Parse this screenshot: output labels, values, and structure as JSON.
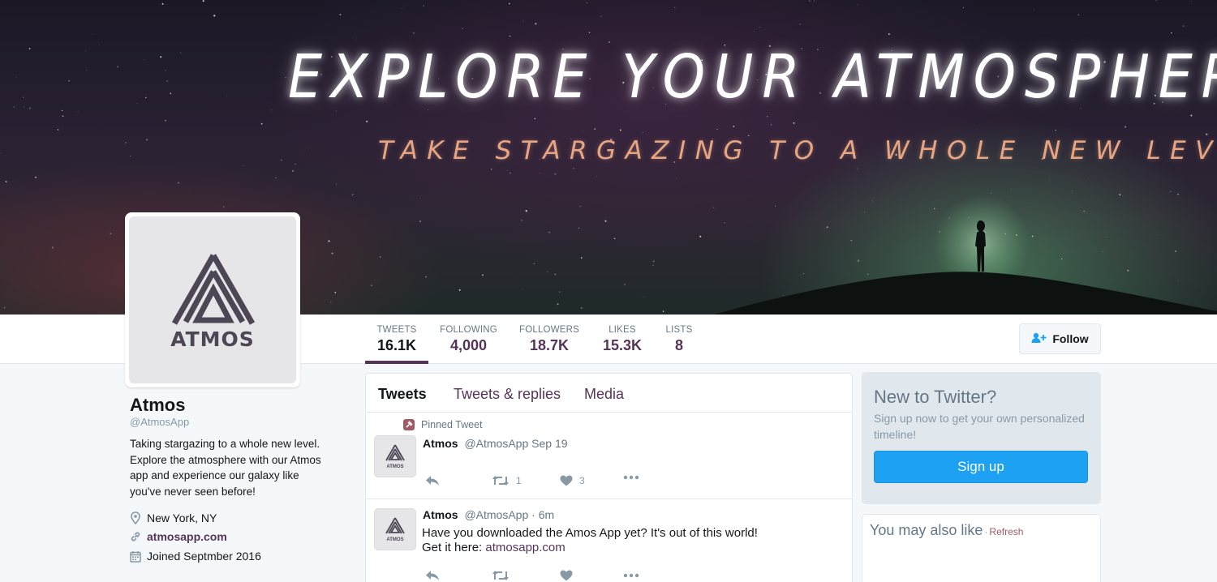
{
  "banner": {
    "title": "EXPLORE YOUR ATMOSPHERE.",
    "subtitle": "TAKE STARGAZING TO A WHOLE NEW LEVEL"
  },
  "profile": {
    "name": "Atmos",
    "handle": "@AtmosApp",
    "bio": "Taking stargazing to a whole new level. Explore the atmosphere with our Atmos app and experience our galaxy like you've never seen before!",
    "location": "New York, NY",
    "website": "atmosapp.com",
    "joined": "Joined Septmber 2016",
    "avatar_text": "ATMOS"
  },
  "stats": [
    {
      "label": "TWEETS",
      "value": "16.1K"
    },
    {
      "label": "FOLLOWING",
      "value": "4,000"
    },
    {
      "label": "FOLLOWERS",
      "value": "18.7K"
    },
    {
      "label": "LIKES",
      "value": "15.3K"
    },
    {
      "label": "LISTS",
      "value": "8"
    }
  ],
  "follow_label": "Follow",
  "tabs": [
    "Tweets",
    "Tweets & replies",
    "Media"
  ],
  "tweets": [
    {
      "pinned_label": "Pinned Tweet",
      "name": "Atmos",
      "handle": "@AtmosApp",
      "time": "Sep 19",
      "retweets": "1",
      "likes": "3"
    },
    {
      "name": "Atmos",
      "handle": "@AtmosApp",
      "time": "· 6m",
      "text": "Have you downloaded the Amos App yet? It's out of this world!",
      "text_line2": "Get it here:",
      "link": "atmosapp.com"
    }
  ],
  "signup": {
    "title": "New to Twitter?",
    "text": "Sign up now to get your own personalized timeline!",
    "button": "Sign up"
  },
  "suggest": {
    "title": "You may also like",
    "separator": "·",
    "refresh": "Refresh"
  },
  "colors": {
    "accent": "#553457",
    "blue": "#1da1f2",
    "banner_sub": "#e8a583"
  },
  "icons": {
    "location": "map-pin-icon",
    "website": "link-icon",
    "joined": "calendar-icon",
    "follow": "add-user-icon",
    "reply": "reply-icon",
    "retweet": "retweet-icon",
    "like": "heart-icon",
    "more": "more-icon",
    "pin": "pin-icon"
  }
}
